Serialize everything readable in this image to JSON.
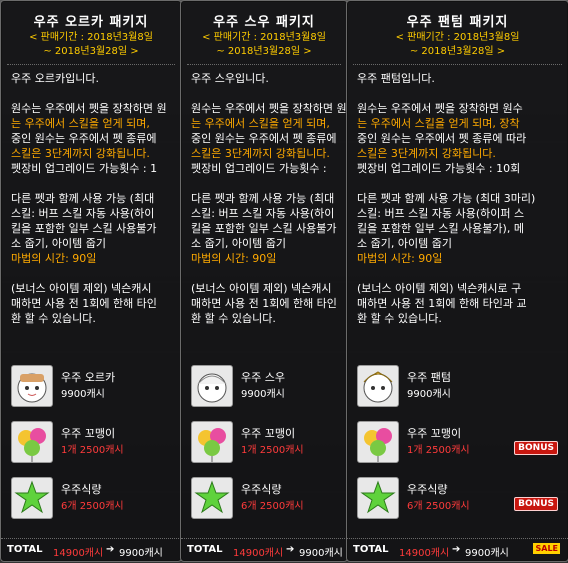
{
  "tooltips": [
    {
      "title": "우주 오르카 패키지",
      "period1": "< 판매기간 : 2018년3월8일",
      "period2": "~ 2018년3월28일 >",
      "lines": {
        "l1": "우주 오르카입니다.",
        "l2a": "원수는 우주에서 펫을 장착하면 원",
        "l3a": "는 우주에서 스킬을 얻게 되며,",
        "l4a": "중인 원수는 우주에서 펫 종류에",
        "l5a": "스킬은 3단계까지 강화됩니다.",
        "l6": "펫장비 업그레이드 가능횟수 : 1",
        "l7": "다른 펫과 함께 사용 가능 (최대",
        "l8": "스킬: 버프 스킬 자동 사용(하이",
        "l9": "킬을 포함한 일부 스킬 사용불가",
        "l10": "소 줍기, 아이템 줍기",
        "l11": "마법의 시간: 90일",
        "l12": "(보너스 아이템 제외) 넥슨캐시",
        "l13": "매하면 사용 전 1회에 한해 타인",
        "l14": "환 할 수 있습니다."
      },
      "items": [
        {
          "name": "우주 오르카",
          "price": "9900캐시",
          "red": false,
          "bonus": ""
        },
        {
          "name": "우주 꼬맹이",
          "price": "1개 2500캐시",
          "red": true,
          "bonus": ""
        },
        {
          "name": "우주식량",
          "price": "6개 2500캐시",
          "red": true,
          "bonus": ""
        }
      ],
      "total": {
        "label": "TOTAL",
        "orig": "14900캐시",
        "arrow": "➔",
        "final": "9900캐시"
      }
    },
    {
      "title": "우주 스우 패키지",
      "period1": "< 판매기간 : 2018년3월8일",
      "period2": "~ 2018년3월28일 >",
      "lines": {
        "l1": "우주 스우입니다.",
        "l2a": "원수는 우주에서 펫을 장착하면 원",
        "l3a": "는 우주에서 스킬을 얻게 되며,",
        "l4a": "중인 원수는 우주에서 펫 종류에",
        "l5a": "스킬은 3단계까지 강화됩니다.",
        "l6": "펫장비 업그레이드 가능횟수 :",
        "l7": "다른 펫과 함께 사용 가능 (최대",
        "l8": "스킬: 버프 스킬 자동 사용(하이",
        "l9": "킬을 포함한 일부 스킬 사용불가",
        "l10": "소 줍기, 아이템 줍기",
        "l11": "마법의 시간: 90일",
        "l12": "(보너스 아이템 제외) 넥슨캐시",
        "l13": "매하면 사용 전 1회에 한해 타인",
        "l14": "환 할 수 있습니다."
      },
      "items": [
        {
          "name": "우주 스우",
          "price": "9900캐시",
          "red": false,
          "bonus": ""
        },
        {
          "name": "우주 꼬맹이",
          "price": "1개 2500캐시",
          "red": true,
          "bonus": ""
        },
        {
          "name": "우주식량",
          "price": "6개 2500캐시",
          "red": true,
          "bonus": ""
        }
      ],
      "total": {
        "label": "TOTAL",
        "orig": "14900캐시",
        "arrow": "➔",
        "final": "9900캐시"
      }
    },
    {
      "title": "우주 팬텀 패키지",
      "period1": "< 판매기간 : 2018년3월8일",
      "period2": "~ 2018년3월28일 >",
      "lines": {
        "l1": "우주 팬텀입니다.",
        "l2a": "원수는 우주에서 펫을 장착하면 원수",
        "l3a": "는 우주에서 스킬을 얻게 되며, 장착",
        "l4a": "중인 원수는 우주에서 펫 종류에 따라",
        "l5a": "스킬은 3단계까지 강화됩니다.",
        "l6": "펫장비 업그레이드 가능횟수 : 10회",
        "l7": "다른 펫과 함께 사용 가능 (최대 3마리)",
        "l8": "스킬: 버프 스킬 자동 사용(하이퍼 스",
        "l9": "킬을 포함한 일부 스킬 사용불가), 메",
        "l10": "소 줍기, 아이템 줍기",
        "l11": "마법의 시간: 90일",
        "l12": "(보너스 아이템 제외) 넥슨캐시로 구",
        "l13": "매하면 사용 전 1회에 한해 타인과 교",
        "l14": "환 할 수 있습니다."
      },
      "items": [
        {
          "name": "우주 팬텀",
          "price": "9900캐시",
          "red": false,
          "bonus": ""
        },
        {
          "name": "우주 꼬맹이",
          "price": "1개 2500캐시",
          "red": true,
          "bonus": "BONUS"
        },
        {
          "name": "우주식량",
          "price": "6개 2500캐시",
          "red": true,
          "bonus": "BONUS"
        }
      ],
      "total": {
        "label": "TOTAL",
        "orig": "14900캐시",
        "arrow": "➔",
        "final": "9900캐시",
        "sale": "SALE"
      }
    }
  ]
}
